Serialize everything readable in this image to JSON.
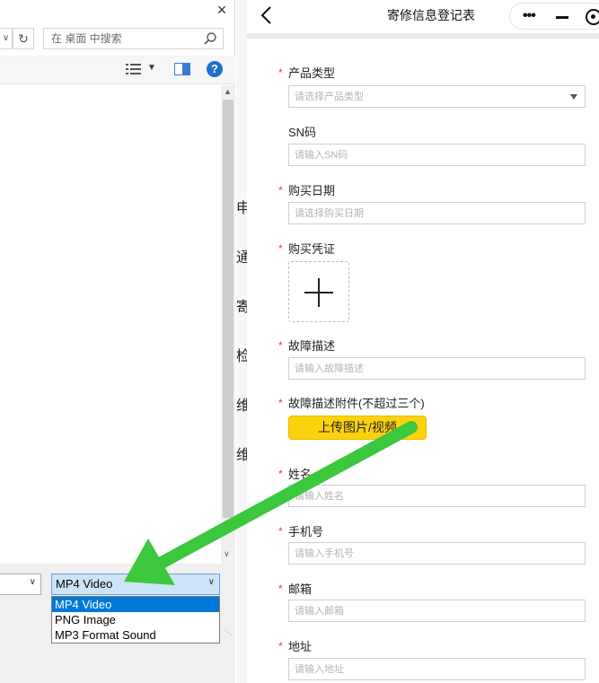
{
  "dialog": {
    "close_glyph": "×",
    "search_placeholder": "在 桌面 中搜索",
    "help_glyph": "?",
    "file_type_selected": "MP4 Video",
    "file_type_options": [
      "MP4 Video",
      "PNG Image",
      "MP3 Format Sound"
    ]
  },
  "middle_strip": {
    "chars": [
      "申",
      "通",
      "寄",
      "检",
      "维",
      "维"
    ]
  },
  "app": {
    "title": "寄修信息登记表",
    "fields": {
      "product_type": {
        "label": "产品类型",
        "placeholder": "请选择产品类型",
        "required": true
      },
      "sn": {
        "label": "SN码",
        "placeholder": "请输入SN码",
        "required": false
      },
      "purchase_date": {
        "label": "购买日期",
        "placeholder": "请选择购买日期",
        "required": true
      },
      "purchase_proof": {
        "label": "购买凭证",
        "required": true
      },
      "fault_desc": {
        "label": "故障描述",
        "placeholder": "请输入故障描述",
        "required": true
      },
      "fault_attach": {
        "label": "故障描述附件(不超过三个)",
        "button": "上传图片/视频",
        "required": true
      },
      "name": {
        "label": "姓名",
        "placeholder": "请输入姓名",
        "required": true
      },
      "phone": {
        "label": "手机号",
        "placeholder": "请输入手机号",
        "required": true
      },
      "email": {
        "label": "邮箱",
        "placeholder": "请输入邮箱",
        "required": true
      },
      "address": {
        "label": "地址",
        "placeholder": "请输入地址",
        "required": true
      }
    },
    "required_mark": "*"
  },
  "colors": {
    "accent_yellow": "#fcd20e",
    "required_red": "#e63c3c",
    "annotation_arrow": "#3cc83c",
    "selection_blue": "#0078d7"
  }
}
